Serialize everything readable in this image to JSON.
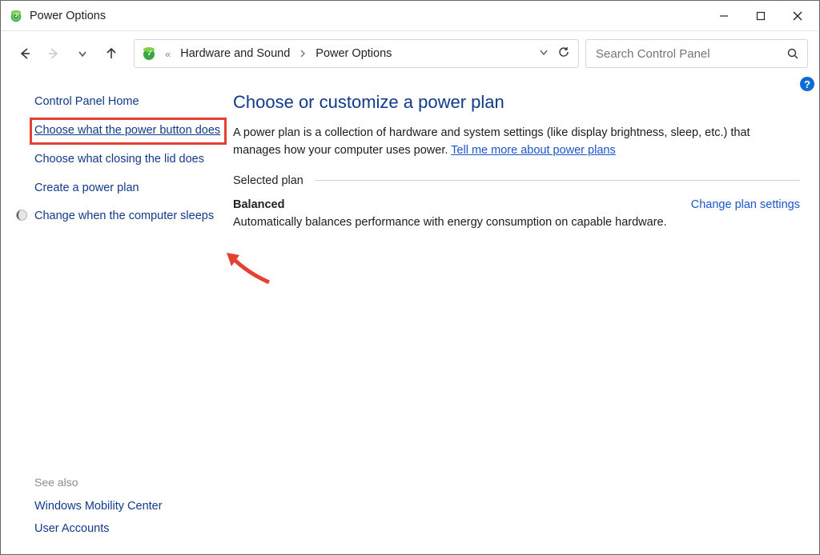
{
  "window": {
    "title": "Power Options"
  },
  "nav": {
    "breadcrumb1": "Hardware and Sound",
    "breadcrumb2": "Power Options",
    "chevrons": "«"
  },
  "search": {
    "placeholder": "Search Control Panel"
  },
  "sidebar": {
    "home": "Control Panel Home",
    "links": {
      "power_button": "Choose what the power button does",
      "lid": "Choose what closing the lid does",
      "create_plan": "Create a power plan",
      "sleep": "Change when the computer sleeps"
    },
    "see_also": "See also",
    "bottom": {
      "mobility": "Windows Mobility Center",
      "accounts": "User Accounts"
    }
  },
  "main": {
    "heading": "Choose or customize a power plan",
    "desc_part1": "A power plan is a collection of hardware and system settings (like display brightness, sleep, etc.) that manages how your computer uses power. ",
    "desc_link": "Tell me more about power plans",
    "section": "Selected plan",
    "plan_name": "Balanced",
    "change_link": "Change plan settings",
    "plan_desc": "Automatically balances performance with energy consumption on capable hardware."
  },
  "help_badge": "?"
}
